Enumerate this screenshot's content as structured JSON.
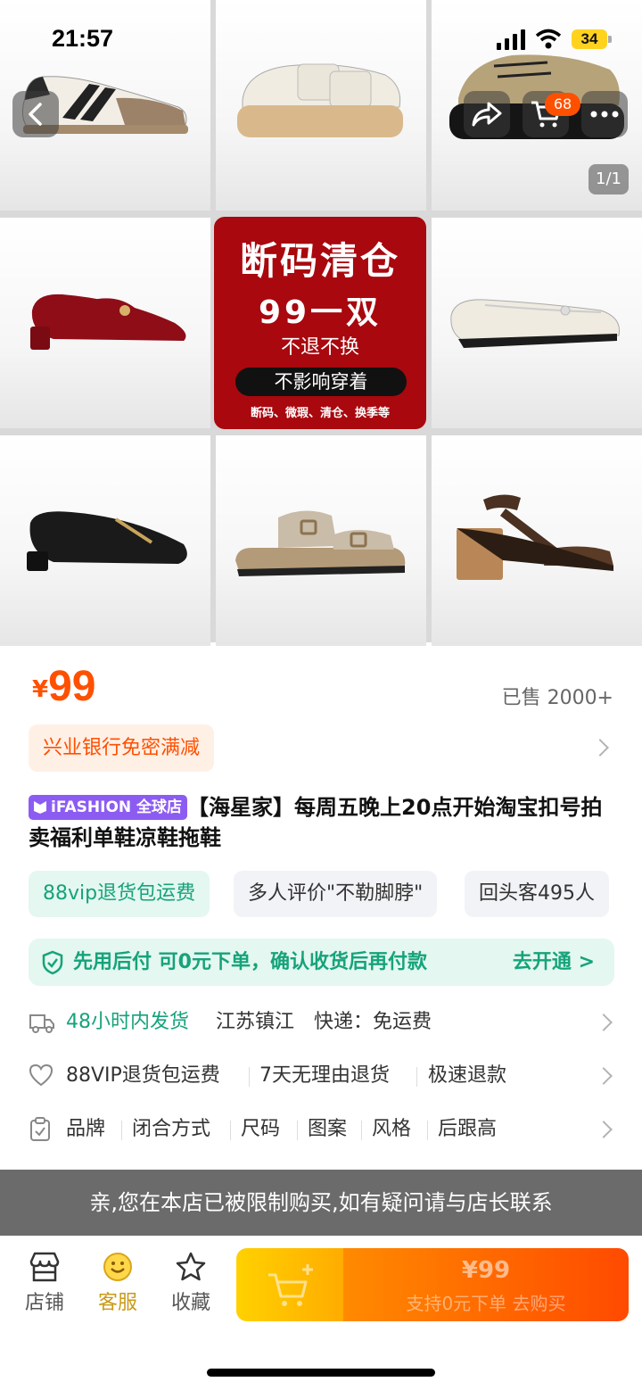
{
  "status_bar": {
    "time": "21:57",
    "battery": "34"
  },
  "header": {
    "cart_count": "68",
    "image_counter": "1/1"
  },
  "promo_image": {
    "headline": "断码清仓",
    "price_line": "99一双",
    "policy": "不退不换",
    "note": "不影响穿着",
    "reasons": "断码、微瑕、清仓、换季等"
  },
  "product": {
    "currency": "¥",
    "price": "99",
    "sold": "已售 2000+",
    "bank_promo": "兴业银行免密满减",
    "brand_badge": "iFASHION 全球店",
    "title": "【海星家】每周五晚上20点开始淘宝扣号拍卖福利单鞋凉鞋拖鞋"
  },
  "tags": [
    "88vip退货包运费",
    "多人评价\"不勒脚脖\"",
    "回头客495人"
  ],
  "bnpl": {
    "text": "先用后付 可0元下单，确认收货后再付款",
    "action": "去开通 >"
  },
  "shipping": {
    "dispatch": "48小时内发货",
    "origin": "江苏镇江",
    "fee": "快递：免运费"
  },
  "service": {
    "items": [
      "88VIP退货包运费",
      "7天无理由退货",
      "极速退款"
    ]
  },
  "params": {
    "items": [
      "品牌",
      "闭合方式",
      "尺码",
      "图案",
      "风格",
      "后跟高"
    ]
  },
  "restriction_notice": "亲,您在本店已被限制购买,如有疑问请与店长联系",
  "bottom_bar": {
    "shop": "店铺",
    "service": "客服",
    "favorite": "收藏",
    "buy_price": "¥99",
    "buy_sub": "支持0元下单 去购买"
  },
  "colors": {
    "accent": "#ff5000",
    "green": "#16a37a",
    "ifashion": "#8c5cf2",
    "promo_red": "#a8080e"
  }
}
